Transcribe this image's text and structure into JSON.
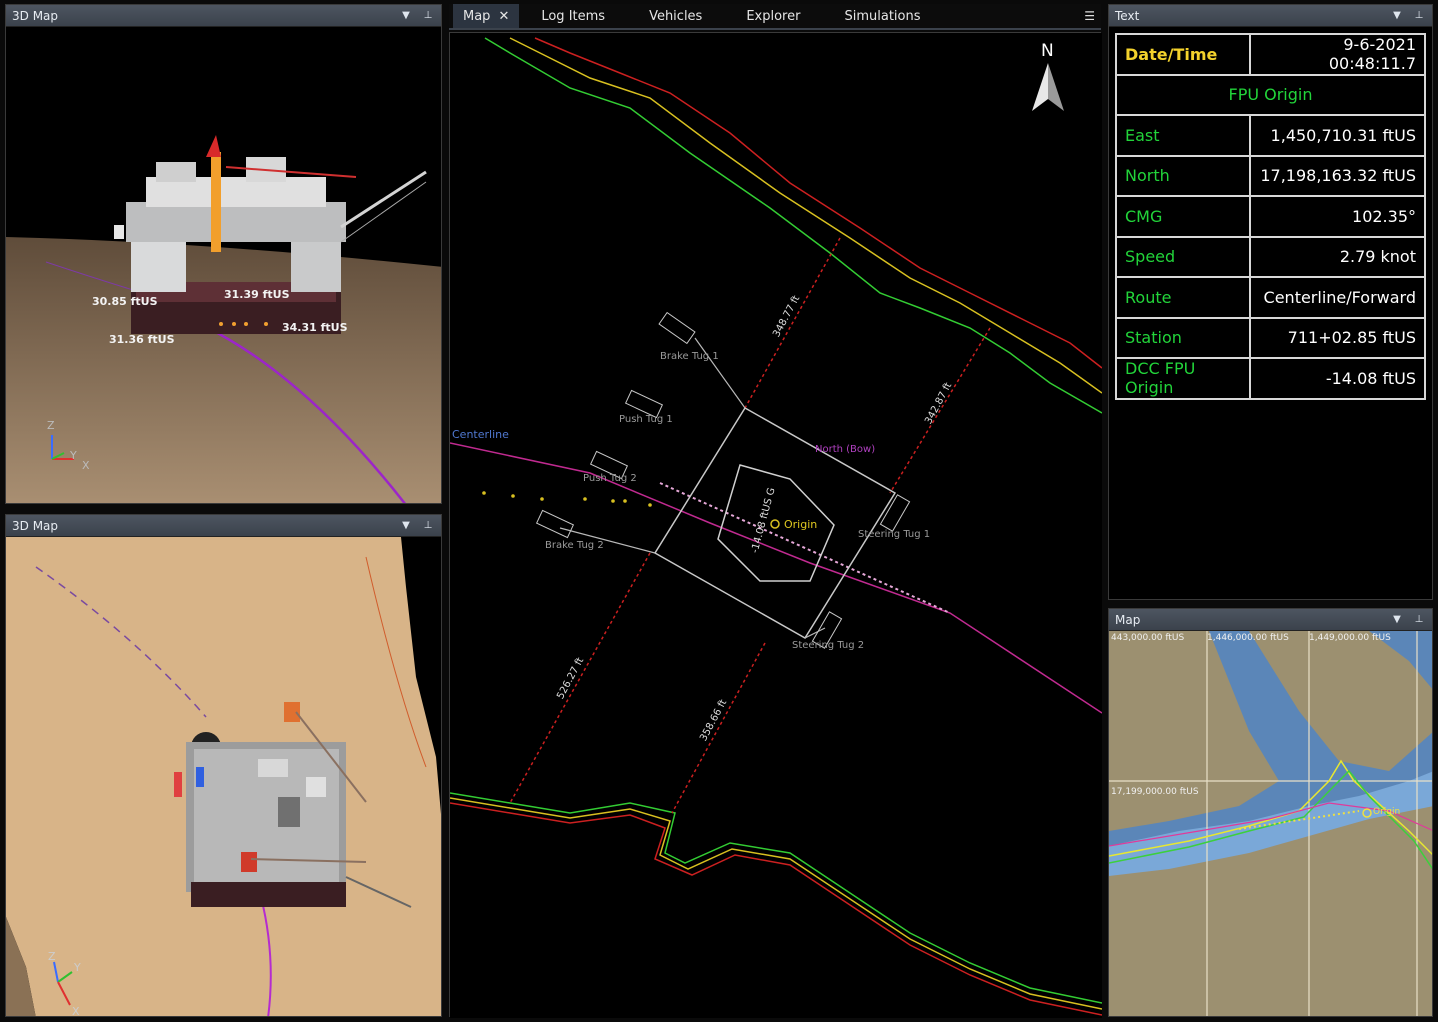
{
  "top_left_panel": {
    "title": "3D Map",
    "depth_labels": [
      "30.85 ftUS",
      "31.39 ftUS",
      "31.36 ftUS",
      "34.31 ftUS"
    ],
    "axes": {
      "z": "Z",
      "x": "X",
      "y": "Y"
    }
  },
  "bottom_left_panel": {
    "title": "3D Map",
    "axes": {
      "z": "Z",
      "y": "Y",
      "x": "X"
    }
  },
  "tabs": [
    {
      "label": "Map",
      "active": true
    },
    {
      "label": "Log Items"
    },
    {
      "label": "Vehicles"
    },
    {
      "label": "Explorer"
    },
    {
      "label": "Simulations"
    }
  ],
  "main_map": {
    "north_label": "N",
    "centerline_label": "Centerline",
    "origin_label": "Origin",
    "north_bow_label": "North (Bow)",
    "vessel_labels": {
      "brake_tug_1": "Brake Tug 1",
      "push_tug_1": "Push Tug 1",
      "push_tug_2": "Push Tug 2",
      "brake_tug_2": "Brake Tug 2",
      "steering_tug_1": "Steering Tug 1",
      "steering_tug_2": "Steering Tug 2"
    },
    "distance_labels": {
      "d1": "348.77 ft",
      "d2": "342.87 ft",
      "d3": "526.27 ft",
      "d4": "358.66 ft"
    },
    "depth_labels": {
      "a": "-14.08 ftUS G"
    }
  },
  "text_panel": {
    "title": "Text",
    "datetime_key": "Date/Time",
    "datetime_value": "9-6-2021 00:48:11.7",
    "section_header": "FPU Origin",
    "rows": [
      {
        "key": "East",
        "value": "1,450,710.31 ftUS"
      },
      {
        "key": "North",
        "value": "17,198,163.32 ftUS"
      },
      {
        "key": "CMG",
        "value": "102.35°"
      },
      {
        "key": "Speed",
        "value": "2.79 knot"
      },
      {
        "key": "Route",
        "value": "Centerline/Forward"
      },
      {
        "key": "Station",
        "value": "711+02.85 ftUS"
      },
      {
        "key": "DCC FPU Origin",
        "value": "-14.08 ftUS"
      }
    ]
  },
  "mini_map": {
    "title": "Map",
    "x_labels": [
      "443,000.00 ftUS",
      "1,446,000.00 ftUS",
      "1,449,000.00 ftUS"
    ],
    "y_label": "17,199,000.00 ftUS",
    "origin_label": "Origin"
  }
}
